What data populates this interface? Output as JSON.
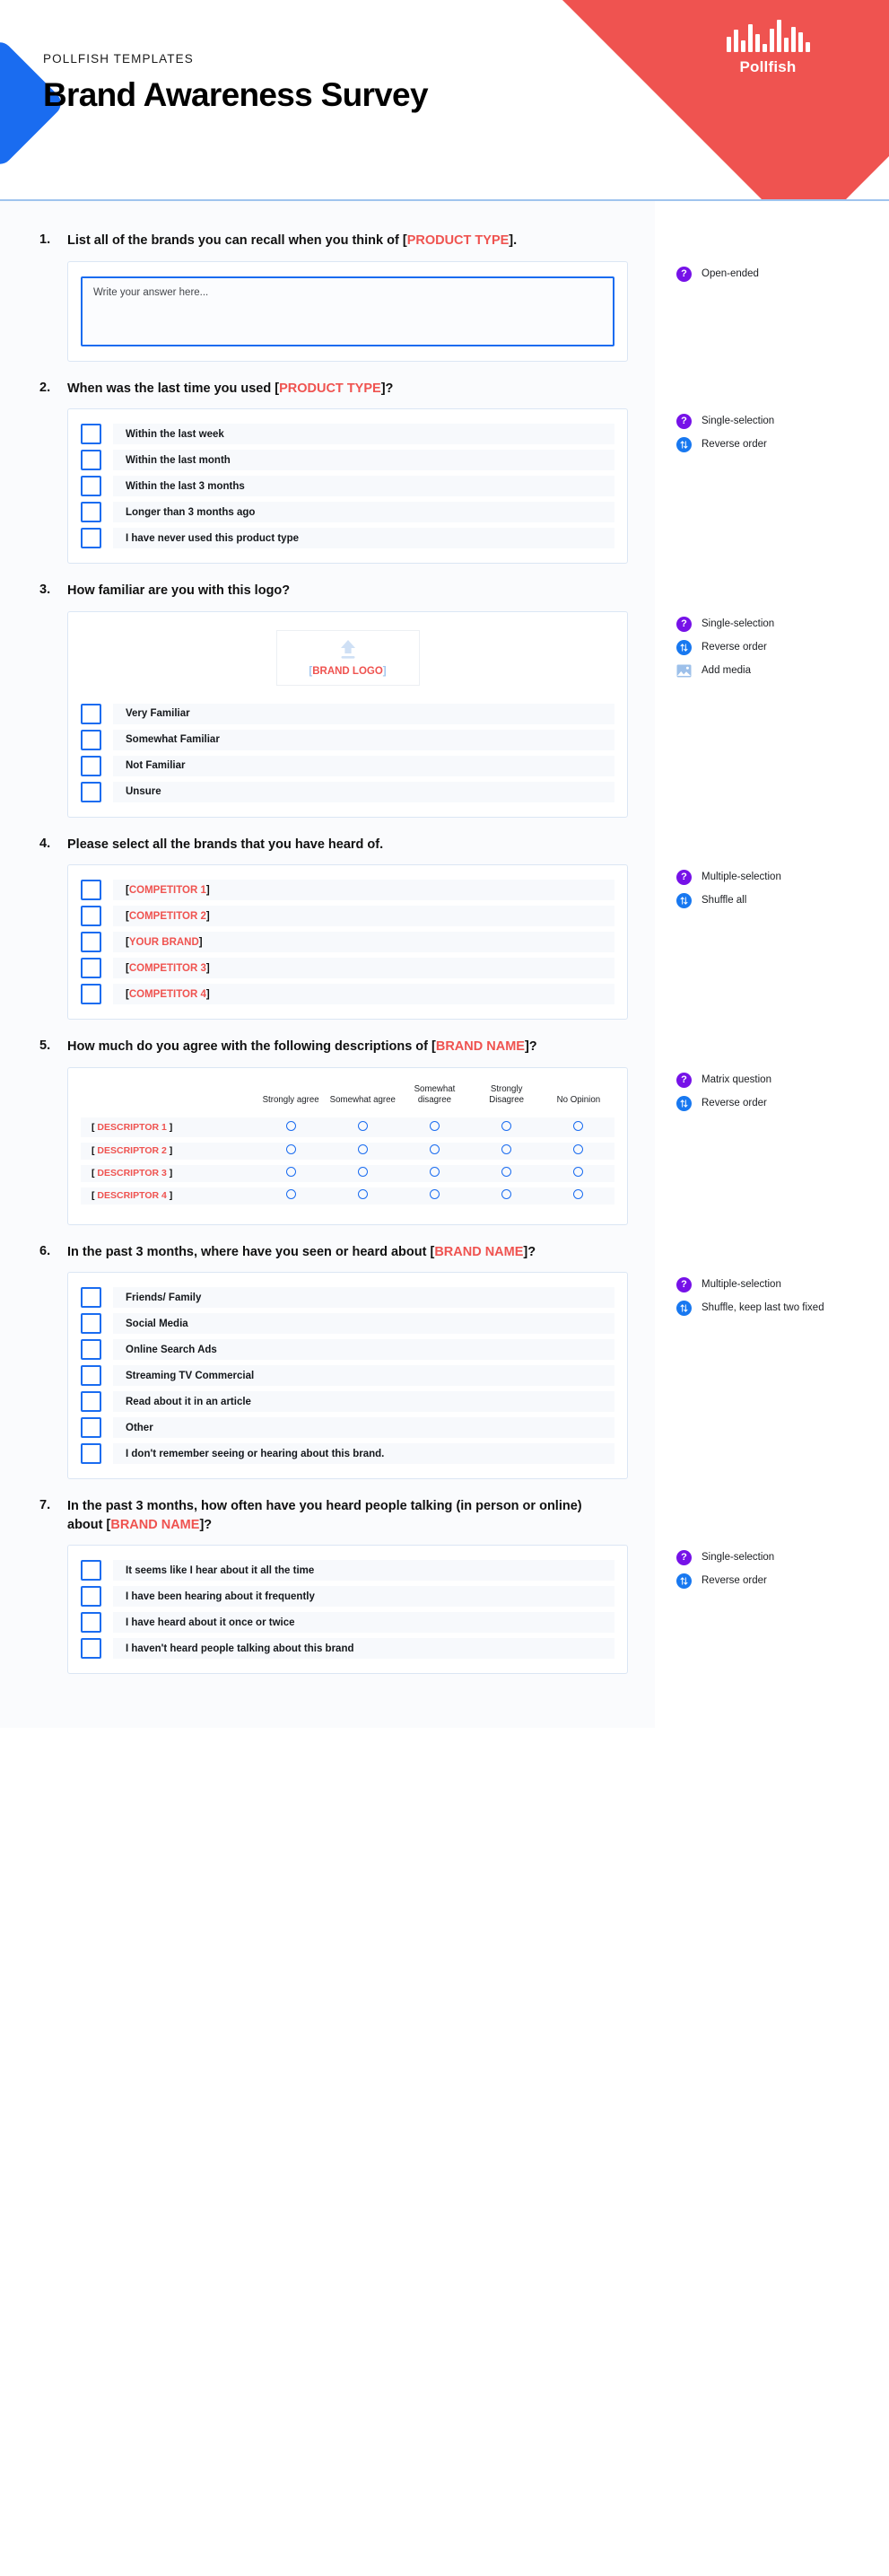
{
  "header": {
    "eyebrow": "POLLFISH TEMPLATES",
    "title": "Brand Awareness Survey",
    "logo_name": "Pollfish",
    "accent_red": "#ef5350",
    "accent_blue": "#1a6cf0",
    "purple": "#7612e8"
  },
  "open_ended_placeholder": "Write your answer here...",
  "media_placeholder": "BRAND LOGO",
  "icon_names": {
    "question_type": "question-mark-icon",
    "order": "reverse-order-icon",
    "media": "add-media-icon",
    "upload": "upload-arrow-icon"
  },
  "questions": [
    {
      "number": "1.",
      "text_parts": [
        {
          "t": "List all of the brands you can recall when you think of ",
          "k": "plain"
        },
        {
          "t": "[",
          "k": "brk"
        },
        {
          "t": "PRODUCT TYPE",
          "k": "ph"
        },
        {
          "t": "].",
          "k": "brk"
        }
      ],
      "type": "open-ended",
      "notes": [
        "Open-ended"
      ],
      "note_icons": [
        "question"
      ],
      "options": []
    },
    {
      "number": "2.",
      "text_parts": [
        {
          "t": "When was the last time you used ",
          "k": "plain"
        },
        {
          "t": "[",
          "k": "brk"
        },
        {
          "t": "PRODUCT TYPE",
          "k": "ph"
        },
        {
          "t": "]?",
          "k": "brk"
        }
      ],
      "type": "options",
      "notes": [
        "Single-selection",
        "Reverse order"
      ],
      "note_icons": [
        "question",
        "order"
      ],
      "options": [
        [
          {
            "t": "Within the last week",
            "k": "plain"
          }
        ],
        [
          {
            "t": "Within the last month",
            "k": "plain"
          }
        ],
        [
          {
            "t": "Within the last 3 months",
            "k": "plain"
          }
        ],
        [
          {
            "t": "Longer than 3 months ago",
            "k": "plain"
          }
        ],
        [
          {
            "t": "I have never used this product type",
            "k": "plain"
          }
        ]
      ]
    },
    {
      "number": "3.",
      "text_parts": [
        {
          "t": "How familiar are you with this logo?",
          "k": "plain"
        }
      ],
      "type": "options-with-media",
      "notes": [
        "Single-selection",
        "Reverse order",
        "Add media"
      ],
      "note_icons": [
        "question",
        "order",
        "media"
      ],
      "options": [
        [
          {
            "t": "Very Familiar",
            "k": "plain"
          }
        ],
        [
          {
            "t": "Somewhat Familiar",
            "k": "plain"
          }
        ],
        [
          {
            "t": "Not Familiar",
            "k": "plain"
          }
        ],
        [
          {
            "t": "Unsure",
            "k": "plain"
          }
        ]
      ]
    },
    {
      "number": "4.",
      "text_parts": [
        {
          "t": "Please select all the brands that you have heard of.",
          "k": "plain"
        }
      ],
      "type": "options",
      "notes": [
        "Multiple-selection",
        "Shuffle all"
      ],
      "note_icons": [
        "question",
        "order"
      ],
      "options": [
        [
          {
            "t": "[",
            "k": "brk"
          },
          {
            "t": "COMPETITOR 1",
            "k": "ph"
          },
          {
            "t": "]",
            "k": "brk"
          }
        ],
        [
          {
            "t": "[",
            "k": "brk"
          },
          {
            "t": "COMPETITOR 2",
            "k": "ph"
          },
          {
            "t": "]",
            "k": "brk"
          }
        ],
        [
          {
            "t": "[",
            "k": "brk"
          },
          {
            "t": "YOUR BRAND",
            "k": "ph"
          },
          {
            "t": "]",
            "k": "brk"
          }
        ],
        [
          {
            "t": "[",
            "k": "brk"
          },
          {
            "t": "COMPETITOR 3",
            "k": "ph"
          },
          {
            "t": "]",
            "k": "brk"
          }
        ],
        [
          {
            "t": "[",
            "k": "brk"
          },
          {
            "t": "COMPETITOR 4",
            "k": "ph"
          },
          {
            "t": "]",
            "k": "brk"
          }
        ]
      ]
    },
    {
      "number": "5.",
      "text_parts": [
        {
          "t": "How much do you agree with the following descriptions of ",
          "k": "plain"
        },
        {
          "t": "[",
          "k": "brk"
        },
        {
          "t": "BRAND NAME",
          "k": "ph"
        },
        {
          "t": "]?",
          "k": "brk"
        }
      ],
      "type": "matrix",
      "notes": [
        "Matrix question",
        "Reverse order"
      ],
      "note_icons": [
        "question",
        "order"
      ],
      "matrix": {
        "columns": [
          "Strongly agree",
          "Somewhat agree",
          "Somewhat disagree",
          "Strongly Disagree",
          "No Opinion"
        ],
        "rows": [
          [
            {
              "t": "[ ",
              "k": "brk"
            },
            {
              "t": "DESCRIPTOR 1",
              "k": "ph"
            },
            {
              "t": " ]",
              "k": "brk"
            }
          ],
          [
            {
              "t": "[ ",
              "k": "brk"
            },
            {
              "t": "DESCRIPTOR 2",
              "k": "ph"
            },
            {
              "t": " ]",
              "k": "brk"
            }
          ],
          [
            {
              "t": "[ ",
              "k": "brk"
            },
            {
              "t": "DESCRIPTOR 3",
              "k": "ph"
            },
            {
              "t": " ]",
              "k": "brk"
            }
          ],
          [
            {
              "t": "[ ",
              "k": "brk"
            },
            {
              "t": "DESCRIPTOR 4",
              "k": "ph"
            },
            {
              "t": " ]",
              "k": "brk"
            }
          ]
        ]
      },
      "options": []
    },
    {
      "number": "6.",
      "text_parts": [
        {
          "t": "In the past 3 months, where have you seen or heard about ",
          "k": "plain"
        },
        {
          "t": "[",
          "k": "brk"
        },
        {
          "t": "BRAND NAME",
          "k": "ph"
        },
        {
          "t": "]?",
          "k": "brk"
        }
      ],
      "type": "options",
      "notes": [
        "Multiple-selection",
        "Shuffle, keep last two fixed"
      ],
      "note_icons": [
        "question",
        "order"
      ],
      "options": [
        [
          {
            "t": "Friends/ Family",
            "k": "plain"
          }
        ],
        [
          {
            "t": "Social Media",
            "k": "plain"
          }
        ],
        [
          {
            "t": "Online Search Ads",
            "k": "plain"
          }
        ],
        [
          {
            "t": "Streaming TV Commercial",
            "k": "plain"
          }
        ],
        [
          {
            "t": "Read about it in an article",
            "k": "plain"
          }
        ],
        [
          {
            "t": "Other",
            "k": "plain"
          }
        ],
        [
          {
            "t": "I don't remember seeing or hearing about this brand.",
            "k": "plain"
          }
        ]
      ]
    },
    {
      "number": "7.",
      "text_parts": [
        {
          "t": "In the past 3 months, how often have you heard people talking (in person or online) about ",
          "k": "plain"
        },
        {
          "t": "[",
          "k": "brk"
        },
        {
          "t": "BRAND NAME",
          "k": "ph"
        },
        {
          "t": "]?",
          "k": "brk"
        }
      ],
      "type": "options",
      "notes": [
        "Single-selection",
        "Reverse order"
      ],
      "note_icons": [
        "question",
        "order"
      ],
      "options": [
        [
          {
            "t": "It seems like I hear about it all the time",
            "k": "plain"
          }
        ],
        [
          {
            "t": "I have been hearing about it frequently",
            "k": "plain"
          }
        ],
        [
          {
            "t": "I have heard about it once or twice",
            "k": "plain"
          }
        ],
        [
          {
            "t": "I haven't heard people talking about this brand",
            "k": "plain"
          }
        ]
      ]
    }
  ]
}
